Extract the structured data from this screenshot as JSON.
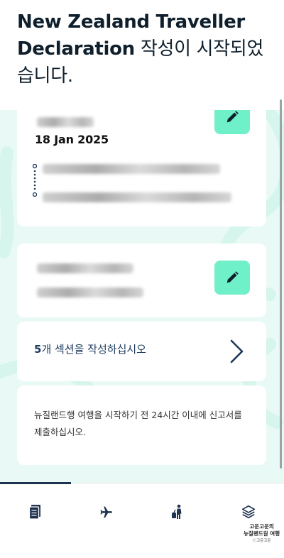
{
  "header": {
    "title_en": "New Zealand Traveller Declaration",
    "title_ko": " 작성이 시작되었습니다.",
    "title_ko_a": " 작성이 시작되었",
    "title_ko_b": "습니다."
  },
  "trip_card": {
    "date": "18 Jan 2025",
    "edit_label": "edit"
  },
  "traveller_card": {
    "edit_label": "edit"
  },
  "sections_card": {
    "count": "5",
    "label": "개 섹션을 작성하십시오"
  },
  "notice_card": {
    "text": "뉴질랜드행 여행을 시작하기 전 24시간 이내에 신고서를 제출하십시오."
  },
  "bottom_nav": {
    "items": [
      {
        "icon": "declaration-icon",
        "active": true
      },
      {
        "icon": "plane-icon",
        "active": false
      },
      {
        "icon": "traveller-luggage-icon",
        "active": false
      },
      {
        "icon": "layers-icon",
        "active": false
      }
    ]
  },
  "watermark": {
    "line1": "고운고운의",
    "line2": "뉴질랜드길 여행",
    "line3": "ⓒ고운고운"
  },
  "colors": {
    "accent": "#6ff0c8",
    "navy": "#1d3a5c",
    "background_tint": "#e9faf6"
  }
}
